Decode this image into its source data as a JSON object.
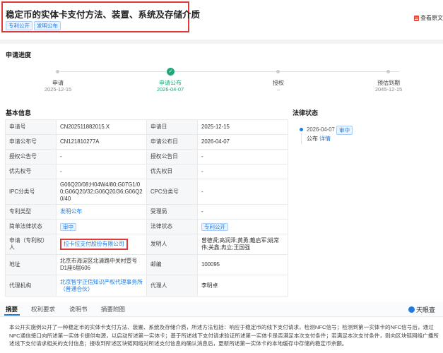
{
  "header": {
    "title": "稳定币的实体卡支付方法、装置、系统及存储介质",
    "tags": [
      "专利公开",
      "发明公布"
    ],
    "view_original": "查看原文",
    "view_icon": "pdf-icon"
  },
  "progress": {
    "title": "申请进度",
    "steps": [
      {
        "label": "申请",
        "date": "2025-12-15",
        "state": "done"
      },
      {
        "label": "申请公布",
        "date": "2026-04-07",
        "state": "current"
      },
      {
        "label": "授权",
        "date": "–",
        "state": "pending"
      },
      {
        "label": "预估到期",
        "date": "2045-12-15",
        "state": "pending"
      }
    ]
  },
  "basic": {
    "title": "基本信息",
    "rows": [
      [
        {
          "k": "申请号",
          "v": "CN202511882015.X"
        },
        {
          "k": "申请日",
          "v": "2025-12-15"
        }
      ],
      [
        {
          "k": "申请公布号",
          "v": "CN121810277A"
        },
        {
          "k": "申请公布日",
          "v": "2026-04-07"
        }
      ],
      [
        {
          "k": "授权公告号",
          "v": "-"
        },
        {
          "k": "授权公告日",
          "v": "-"
        }
      ],
      [
        {
          "k": "优先权号",
          "v": "-"
        },
        {
          "k": "优先权日",
          "v": "-"
        }
      ],
      [
        {
          "k": "IPC分类号",
          "v": "G06Q20/08;H04W4/80;G07G1/00;G06Q20/32;G06Q20/36;G06Q20/40"
        },
        {
          "k": "CPC分类号",
          "v": "-"
        }
      ],
      [
        {
          "k": "专利类型",
          "v": "发明公布"
        },
        {
          "k": "受理局",
          "v": "-"
        }
      ],
      [
        {
          "k": "简单法律状态",
          "v": "审中"
        },
        {
          "k": "法律状态",
          "v": "专利公开"
        }
      ],
      [
        {
          "k": "申请（专利权）人",
          "v": "拉卡拉支付股份有限公司"
        },
        {
          "k": "发明人",
          "v": "曾德贤;高润泽;黄勇;戴启军;姚常伟;关鑫;冉立;王国强"
        }
      ],
      [
        {
          "k": "地址",
          "v": "北京市海淀区北清路中关村壹号D1座6层606"
        },
        {
          "k": "邮编",
          "v": "100095"
        }
      ],
      [
        {
          "k": "代理机构",
          "v": "北京智宇正信知识产权代理事务所（普通合伙）"
        },
        {
          "k": "代理人",
          "v": "李明卓"
        }
      ]
    ]
  },
  "legal": {
    "title": "法律状态",
    "date": "2026-04-07",
    "badge": "审中",
    "event": "公布",
    "detail_link": "详情"
  },
  "tabs": [
    "摘要",
    "权利要求",
    "说明书",
    "摘要附图"
  ],
  "brand": "天眼查",
  "brand_icon": "tianyancha-logo-icon",
  "abstract": "本公开实施例公开了一种稳定币的实体卡支付方法、装置、系统及存储介质，所述方法包括：响应于稳定币的线下支付请求，检测NFC信号；检测到第一实体卡的NFC信号后，通过NFC通信接口向所述第一实体卡提供电源，以启动所述第一实体卡；基于所述线下支付请求验证所述第一实体卡是否满足本次支付条件；若满足本次支付条件，则向区块链网络广播所述线下支付请求相关的支付信息；接收到所述区块链网络对所述支付信息的确认消息后，更新所述第一实体卡的本地缓存中存储的稳定币余额。",
  "colors": {
    "accent": "#1e7ae0",
    "success": "#21a77a",
    "highlight": "#e03a3a"
  }
}
